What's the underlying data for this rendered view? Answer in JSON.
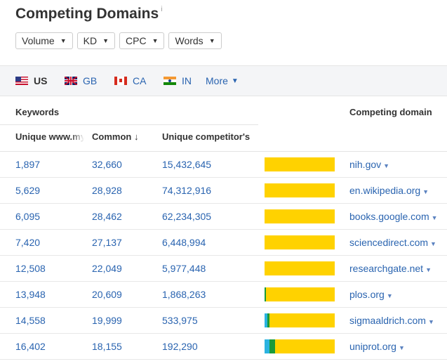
{
  "title": "Competing Domains",
  "title_info": "i",
  "filters": [
    {
      "label": "Volume"
    },
    {
      "label": "KD"
    },
    {
      "label": "CPC"
    },
    {
      "label": "Words"
    }
  ],
  "countries": [
    {
      "code": "US",
      "active": true
    },
    {
      "code": "GB",
      "active": false
    },
    {
      "code": "CA",
      "active": false
    },
    {
      "code": "IN",
      "active": false
    }
  ],
  "more_label": "More",
  "table": {
    "group_header": "Keywords",
    "domain_header": "Competing domain",
    "col_unique_mine": "Unique www.my",
    "col_common": "Common",
    "col_common_sort": "↓",
    "col_unique_competitor": "Unique competitor's",
    "bar_colors": {
      "unique_mine": "#2bb3e0",
      "common": "#1a9a3a",
      "unique_competitor": "#ffd200"
    },
    "rows": [
      {
        "unique_mine": "1,897",
        "common": "32,660",
        "unique_competitor": "15,432,645",
        "domain": "nih.gov",
        "bar": [
          0.0,
          0.0,
          1.0
        ]
      },
      {
        "unique_mine": "5,629",
        "common": "28,928",
        "unique_competitor": "74,312,916",
        "domain": "en.wikipedia.org",
        "bar": [
          0.0,
          0.0,
          1.0
        ]
      },
      {
        "unique_mine": "6,095",
        "common": "28,462",
        "unique_competitor": "62,234,305",
        "domain": "books.google.com",
        "bar": [
          0.0,
          0.0,
          1.0
        ]
      },
      {
        "unique_mine": "7,420",
        "common": "27,137",
        "unique_competitor": "6,448,994",
        "domain": "sciencedirect.com",
        "bar": [
          0.0,
          0.0,
          1.0
        ]
      },
      {
        "unique_mine": "12,508",
        "common": "22,049",
        "unique_competitor": "5,977,448",
        "domain": "researchgate.net",
        "bar": [
          0.0,
          0.0,
          1.0
        ]
      },
      {
        "unique_mine": "13,948",
        "common": "20,609",
        "unique_competitor": "1,868,263",
        "domain": "plos.org",
        "bar": [
          0.0,
          0.02,
          0.98
        ]
      },
      {
        "unique_mine": "14,558",
        "common": "19,999",
        "unique_competitor": "533,975",
        "domain": "sigmaaldrich.com",
        "bar": [
          0.04,
          0.03,
          0.93
        ]
      },
      {
        "unique_mine": "16,402",
        "common": "18,155",
        "unique_competitor": "192,290",
        "domain": "uniprot.org",
        "bar": [
          0.07,
          0.08,
          0.85
        ]
      }
    ]
  }
}
